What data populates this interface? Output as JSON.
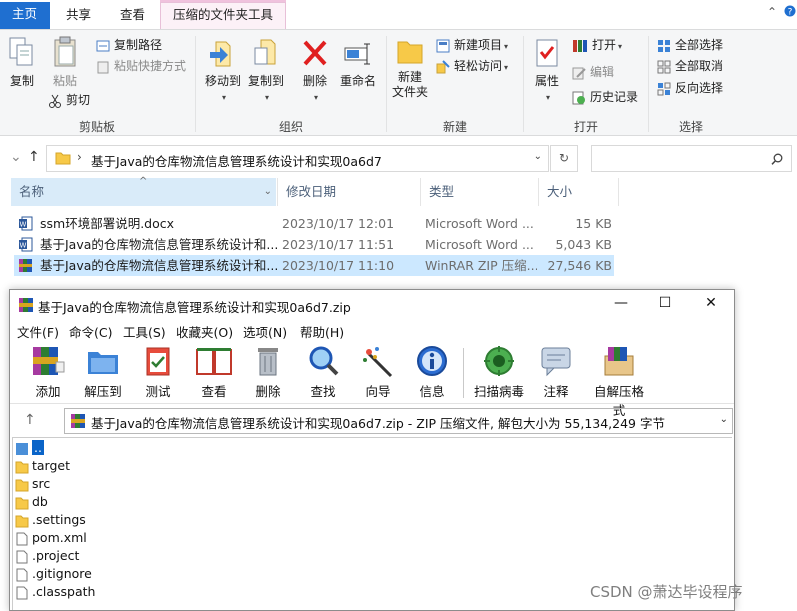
{
  "explorer": {
    "tabs": {
      "home": "主页",
      "share": "共享",
      "view": "查看",
      "zip_tools": "压缩的文件夹工具"
    },
    "ribbon": {
      "clipboard": {
        "group": "剪贴板",
        "copy": "复制",
        "paste": "粘贴",
        "copy_path": "复制路径",
        "paste_shortcut": "粘贴快捷方式",
        "cut": "剪切"
      },
      "organize": {
        "group": "组织",
        "move_to": "移动到",
        "copy_to": "复制到",
        "delete": "删除",
        "rename": "重命名"
      },
      "new": {
        "group": "新建",
        "new_folder": "新建\n文件夹",
        "new_item": "新建项目",
        "easy_access": "轻松访问"
      },
      "open": {
        "group": "打开",
        "properties": "属性",
        "open": "打开",
        "edit": "编辑",
        "history": "历史记录"
      },
      "select": {
        "group": "选择",
        "select_all": "全部选择",
        "select_none": "全部取消",
        "invert": "反向选择"
      }
    },
    "address": {
      "path": "基于Java的仓库物流信息管理系统设计和实现0a6d7",
      "search_placeholder": ""
    },
    "columns": {
      "name": "名称",
      "date": "修改日期",
      "type": "类型",
      "size": "大小"
    },
    "files": [
      {
        "name": "ssm环境部署说明.docx",
        "date": "2023/10/17 12:01",
        "type": "Microsoft Word ...",
        "size": "15 KB",
        "icon": "word-icon"
      },
      {
        "name": "基于Java的仓库物流信息管理系统设计和...",
        "date": "2023/10/17 11:51",
        "type": "Microsoft Word ...",
        "size": "5,043 KB",
        "icon": "word-icon"
      },
      {
        "name": "基于Java的仓库物流信息管理系统设计和...",
        "date": "2023/10/17 11:10",
        "type": "WinRAR ZIP 压缩...",
        "size": "27,546 KB",
        "icon": "winrar-icon"
      }
    ]
  },
  "winrar": {
    "title": "基于Java的仓库物流信息管理系统设计和实现0a6d7.zip",
    "menu": [
      "文件(F)",
      "命令(C)",
      "工具(S)",
      "收藏夹(O)",
      "选项(N)",
      "帮助(H)"
    ],
    "toolbar": [
      "添加",
      "解压到",
      "测试",
      "查看",
      "删除",
      "查找",
      "向导",
      "信息",
      "扫描病毒",
      "注释",
      "自解压格式"
    ],
    "path_text": "基于Java的仓库物流信息管理系统设计和实现0a6d7.zip - ZIP 压缩文件, 解包大小为 55,134,249 字节",
    "items": [
      {
        "name": "..",
        "kind": "up"
      },
      {
        "name": "target",
        "kind": "folder"
      },
      {
        "name": "src",
        "kind": "folder"
      },
      {
        "name": "db",
        "kind": "folder"
      },
      {
        "name": ".settings",
        "kind": "folder"
      },
      {
        "name": "pom.xml",
        "kind": "file"
      },
      {
        "name": ".project",
        "kind": "file"
      },
      {
        "name": ".gitignore",
        "kind": "file"
      },
      {
        "name": ".classpath",
        "kind": "file"
      }
    ]
  },
  "watermark": "CSDN @萧达毕设程序",
  "colors": {
    "accent": "#1f6fd0",
    "selection": "#cce8ff",
    "folder": "#f7c948",
    "header_bg": "#d9ebf9"
  }
}
